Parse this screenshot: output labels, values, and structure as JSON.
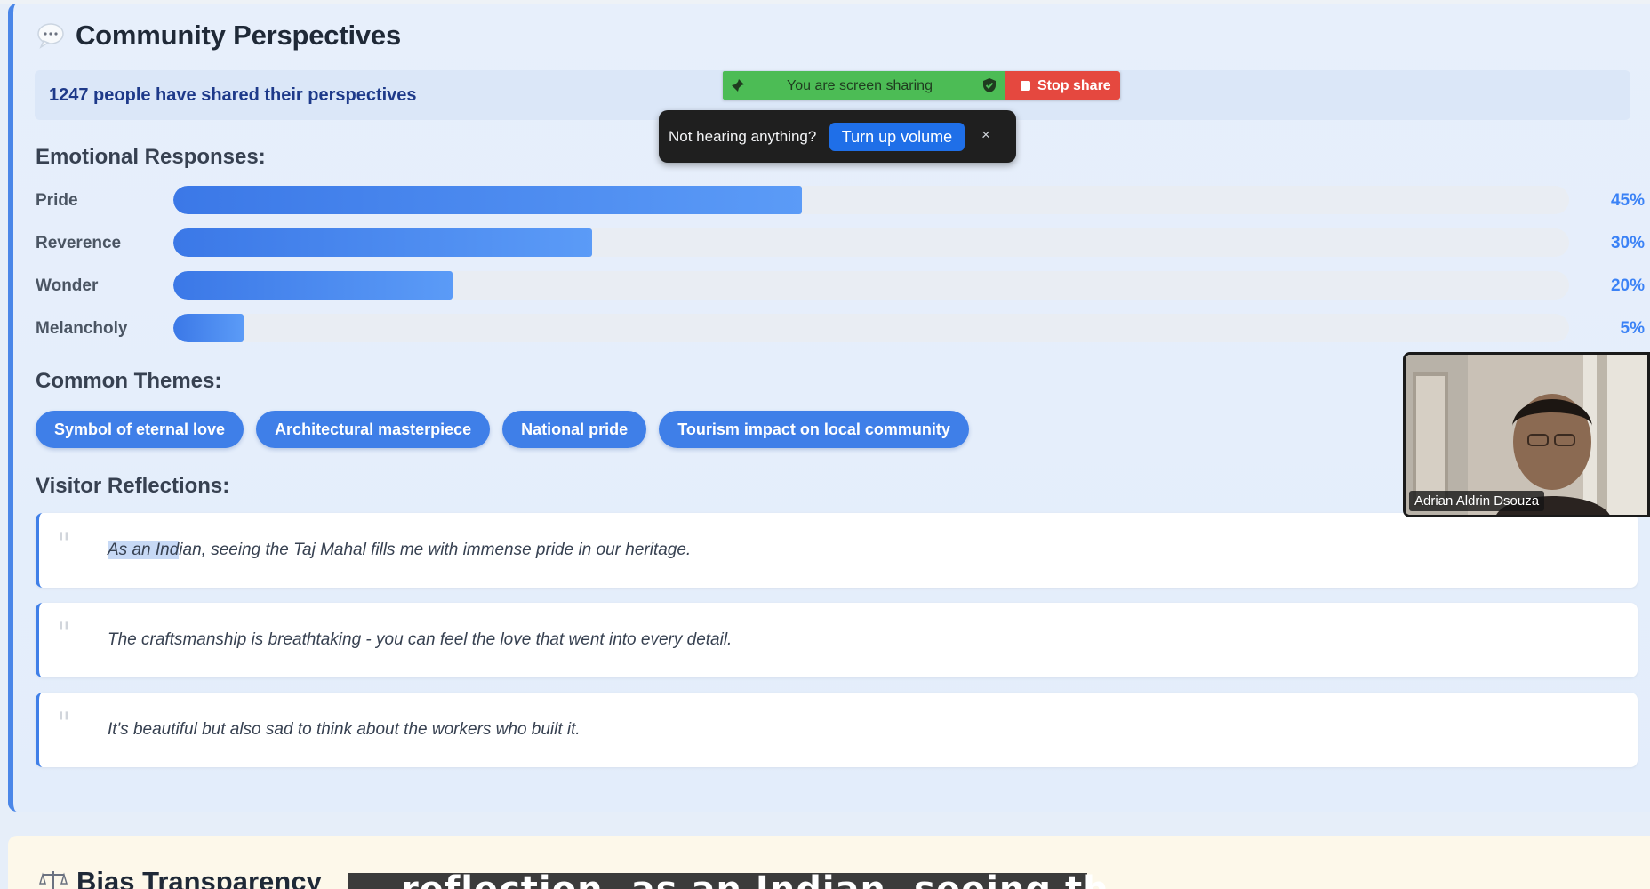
{
  "community": {
    "title": "Community Perspectives",
    "shared_count_text": "1247 people have shared their perspectives"
  },
  "emotional": {
    "heading": "Emotional Responses:",
    "items": [
      {
        "label": "Pride",
        "percent": 45,
        "percent_text": "45%"
      },
      {
        "label": "Reverence",
        "percent": 30,
        "percent_text": "30%"
      },
      {
        "label": "Wonder",
        "percent": 20,
        "percent_text": "20%"
      },
      {
        "label": "Melancholy",
        "percent": 5,
        "percent_text": "5%"
      }
    ]
  },
  "themes": {
    "heading": "Common Themes:",
    "items": [
      "Symbol of eternal love",
      "Architectural masterpiece",
      "National pride",
      "Tourism impact on local community"
    ]
  },
  "reflections": {
    "heading": "Visitor Reflections:",
    "items": [
      {
        "selected": "As an Ind",
        "rest": "ian, seeing the Taj Mahal fills me with immense pride in our heritage."
      },
      {
        "selected": "",
        "rest": "The craftsmanship is breathtaking - you can feel the love that went into every detail."
      },
      {
        "selected": "",
        "rest": "It's beautiful but also sad to think about the workers who built it."
      }
    ]
  },
  "bias": {
    "title": "Bias Transparency"
  },
  "caption": {
    "text": "reflection, as an Indian, seeing th"
  },
  "screen_share": {
    "status": "You are screen sharing",
    "stop_label": "Stop share",
    "status_color": "#4cbc55",
    "stop_color": "#e5483f"
  },
  "volume_toast": {
    "message": "Not hearing anything?",
    "button": "Turn up volume",
    "close": "×"
  },
  "video": {
    "participant_name": "Adrian Aldrin Dsouza"
  },
  "colors": {
    "accent": "#3f7fe8",
    "card_bg": "#e4edfb"
  }
}
